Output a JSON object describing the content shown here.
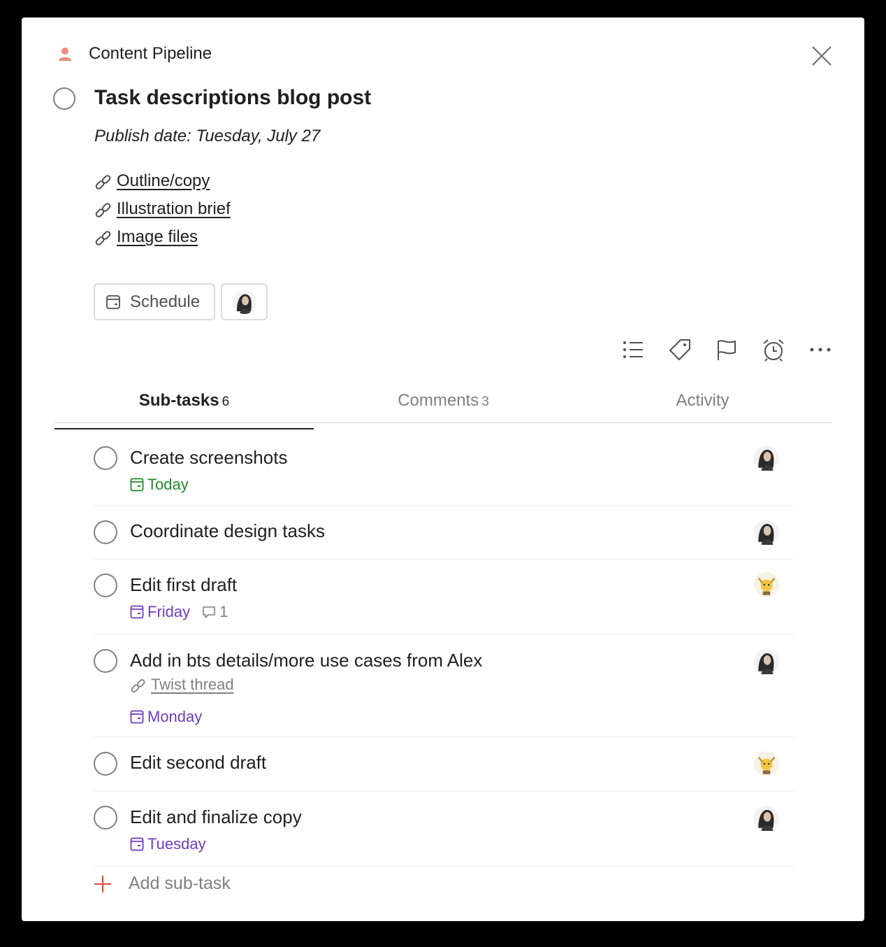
{
  "project": {
    "name": "Content Pipeline",
    "icon": "person-icon",
    "icon_color": "#eb8c7f"
  },
  "task": {
    "title": "Task descriptions blog post",
    "publish_line": "Publish date: Tuesday, July 27",
    "links": [
      "Outline/copy",
      "Illustration brief",
      "Image files"
    ]
  },
  "actions": {
    "schedule_label": "Schedule"
  },
  "toolbar": [
    "subtasks-list-icon",
    "label-icon",
    "flag-icon",
    "alarm-icon",
    "more-icon"
  ],
  "tabs": [
    {
      "label": "Sub-tasks",
      "count": "6",
      "active": true
    },
    {
      "label": "Comments",
      "count": "3",
      "active": false
    },
    {
      "label": "Activity",
      "count": "",
      "active": false
    }
  ],
  "subtasks": [
    {
      "title": "Create screenshots",
      "due": "Today",
      "due_color": "#25872b",
      "avatar": "woman-avatar"
    },
    {
      "title": "Coordinate design tasks",
      "avatar": "woman-avatar"
    },
    {
      "title": "Edit first draft",
      "due": "Friday",
      "due_color": "#6b3fc2",
      "comments": "1",
      "avatar": "emoji-avatar"
    },
    {
      "title": "Add in bts details/more use cases from Alex",
      "link": "Twist thread",
      "due": "Monday",
      "due_color": "#6b3fc2",
      "avatar": "woman-avatar"
    },
    {
      "title": "Edit second draft",
      "avatar": "emoji-avatar"
    },
    {
      "title": "Edit and finalize copy",
      "due": "Tuesday",
      "due_color": "#6b3fc2",
      "avatar": "woman-avatar"
    }
  ],
  "add_subtask_label": "Add sub-task",
  "colors": {
    "accent_red": "#dc4c3e",
    "today_green": "#25872b",
    "date_purple": "#6b3fc2"
  }
}
